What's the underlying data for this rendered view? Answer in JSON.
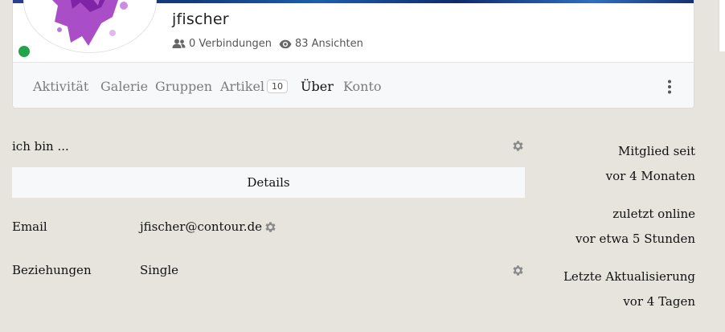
{
  "profile": {
    "username": "jfischer",
    "connections": "0 Verbindungen",
    "views": "83 Ansichten",
    "online_status_color": "#23a34a"
  },
  "nav": {
    "items": [
      {
        "label": "Aktivität"
      },
      {
        "label": "Galerie"
      },
      {
        "label": "Gruppen"
      },
      {
        "label": "Artikel",
        "badge": "10"
      },
      {
        "label": "Über",
        "active": true
      },
      {
        "label": "Konto"
      }
    ],
    "more_icon": "kebab-vertical-icon"
  },
  "about": {
    "intro_label": "ich bin ...",
    "details_header": "Details",
    "fields": [
      {
        "label": "Email",
        "value": "jfischer@contour.de"
      },
      {
        "label": "Beziehungen",
        "value": "Single"
      }
    ]
  },
  "sidebar": {
    "member_since_label": "Mitglied seit",
    "member_since_value": "vor 4 Monaten",
    "last_online_label": "zuletzt online",
    "last_online_value": "vor etwa 5 Stunden",
    "last_update_label": "Letzte Aktualisierung",
    "last_update_value": "vor 4 Tagen"
  },
  "colors": {
    "page_bg": "#e7e4de",
    "card_bg": "#ffffff",
    "nav_bg": "#f7f8fa",
    "online": "#23a34a"
  }
}
